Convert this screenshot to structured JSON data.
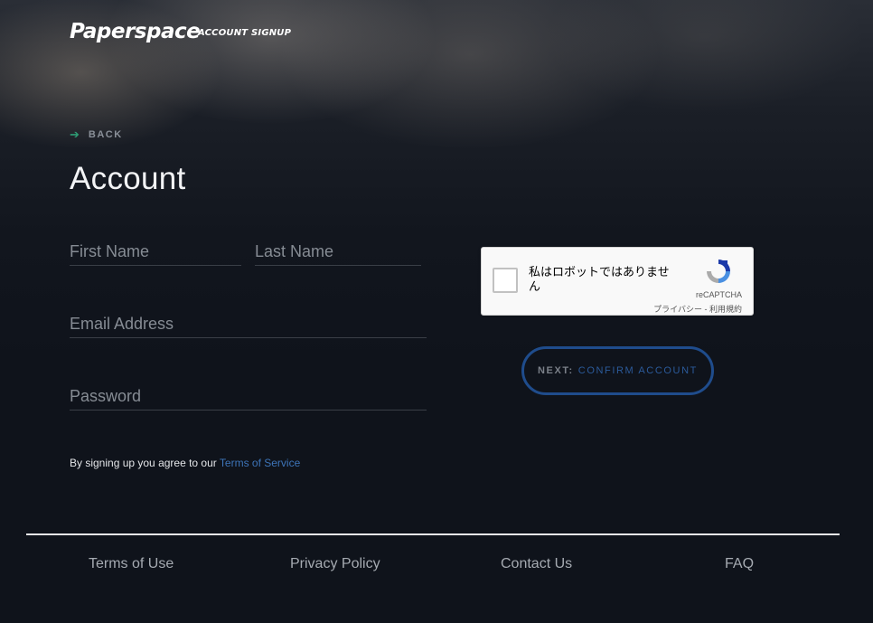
{
  "brand": {
    "logo_text": "Paperspace",
    "tagline": "ACCOUNT SIGNUP"
  },
  "back": {
    "label": "BACK"
  },
  "page": {
    "title": "Account"
  },
  "form": {
    "first_name_placeholder": "First Name",
    "last_name_placeholder": "Last Name",
    "email_placeholder": "Email Address",
    "password_placeholder": "Password",
    "first_name_value": "",
    "last_name_value": "",
    "email_value": "",
    "password_value": ""
  },
  "terms": {
    "prefix": "By signing up you agree to our",
    "link": "Terms of Service"
  },
  "recaptcha": {
    "label": "私はロボットではありません",
    "brand": "reCAPTCHA",
    "links": "プライバシー - 利用規約"
  },
  "next_button": {
    "prefix": "NEXT:",
    "action": "CONFIRM ACCOUNT"
  },
  "footer": {
    "links": [
      "Terms of Use",
      "Privacy Policy",
      "Contact Us",
      "FAQ"
    ]
  },
  "colors": {
    "accent_green": "#2e9c74",
    "link_blue": "#3d74b8",
    "button_border": "#1f4c8c",
    "background": "#0f131b"
  }
}
